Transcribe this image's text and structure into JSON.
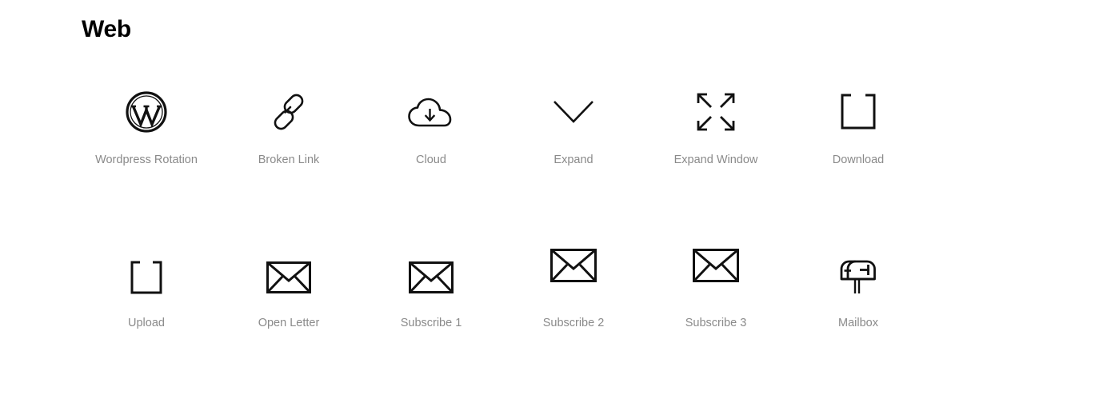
{
  "page": {
    "title": "Web",
    "background_color": "#ffffff",
    "icon_color": "#111111",
    "label_color": "#8a8a8a"
  },
  "grid": {
    "columns": 6,
    "rows": 2,
    "items": [
      {
        "label": "Wordpress Rotation",
        "icon": "wordpress-icon"
      },
      {
        "label": "Broken Link",
        "icon": "broken-link-icon"
      },
      {
        "label": "Cloud",
        "icon": "cloud-download-icon"
      },
      {
        "label": "Expand",
        "icon": "chevron-down-icon"
      },
      {
        "label": "Expand Window",
        "icon": "expand-arrows-icon"
      },
      {
        "label": "Download",
        "icon": "download-tray-icon"
      },
      {
        "label": "Upload",
        "icon": "upload-tray-icon"
      },
      {
        "label": "Open Letter",
        "icon": "envelope-icon"
      },
      {
        "label": "Subscribe 1",
        "icon": "envelope-icon"
      },
      {
        "label": "Subscribe 2",
        "icon": "envelope-icon"
      },
      {
        "label": "Subscribe 3",
        "icon": "envelope-icon"
      },
      {
        "label": "Mailbox",
        "icon": "mailbox-icon"
      }
    ]
  }
}
